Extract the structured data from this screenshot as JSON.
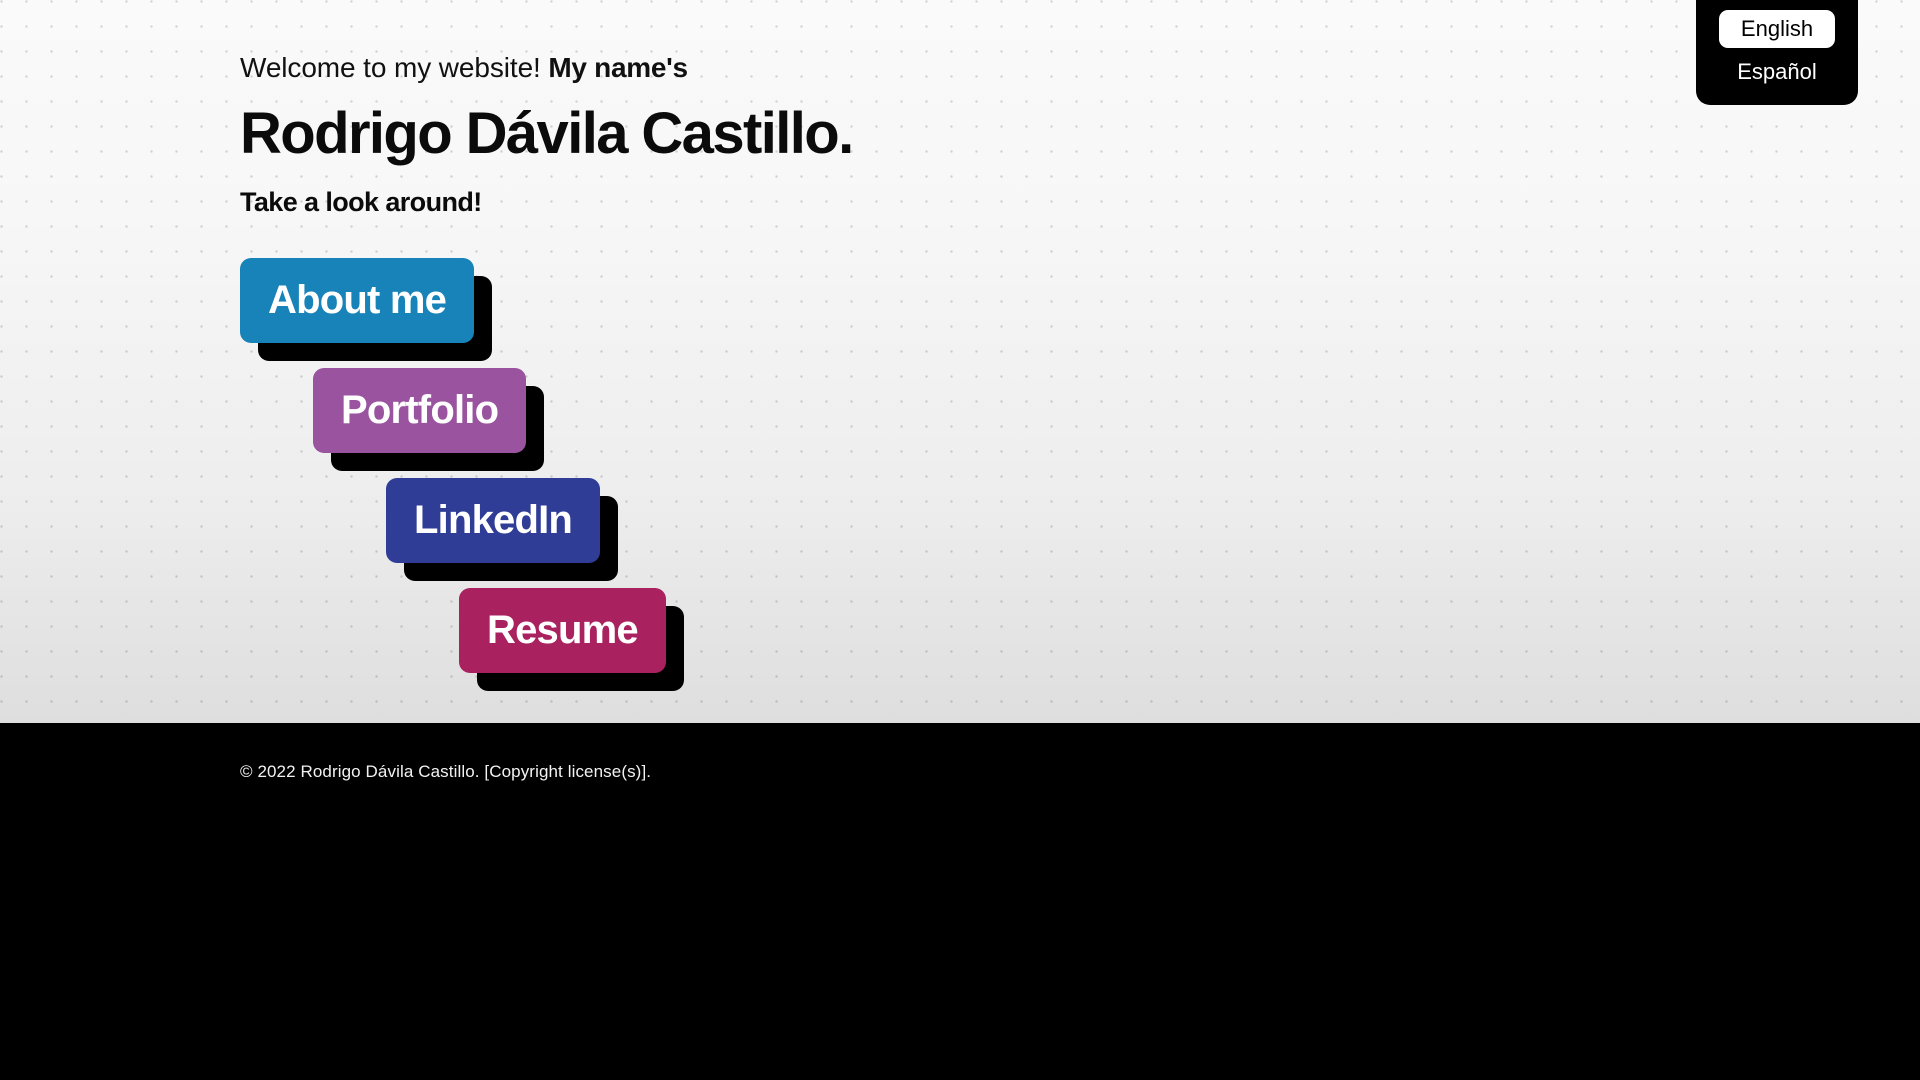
{
  "language_switcher": {
    "options": [
      {
        "label": "English",
        "selected": true
      },
      {
        "label": "Español",
        "selected": false
      }
    ]
  },
  "hero": {
    "welcome_text": "Welcome to my website! ",
    "welcome_bold": "My name's",
    "full_name": "Rodrigo Dávila Castillo.",
    "tagline": "Take a look around!"
  },
  "nav_buttons": [
    {
      "label": "About me",
      "color": "#1883b8",
      "indent": 0,
      "name": "about-me-button"
    },
    {
      "label": "Portfolio",
      "color": "#9a539f",
      "indent": 73,
      "name": "portfolio-button"
    },
    {
      "label": "LinkedIn",
      "color": "#303d96",
      "indent": 146,
      "name": "linkedin-button"
    },
    {
      "label": "Resume",
      "color": "#a9215f",
      "indent": 219,
      "name": "resume-button"
    }
  ],
  "footer": {
    "copyright": "© 2022 Rodrigo Dávila Castillo. [Copyright license(s)]."
  },
  "theme": {
    "background": "#f7f7f7",
    "footer_background": "#000000",
    "shadow": "#000000",
    "text_dark": "#0b0b0b",
    "text_light": "#ffffff"
  }
}
